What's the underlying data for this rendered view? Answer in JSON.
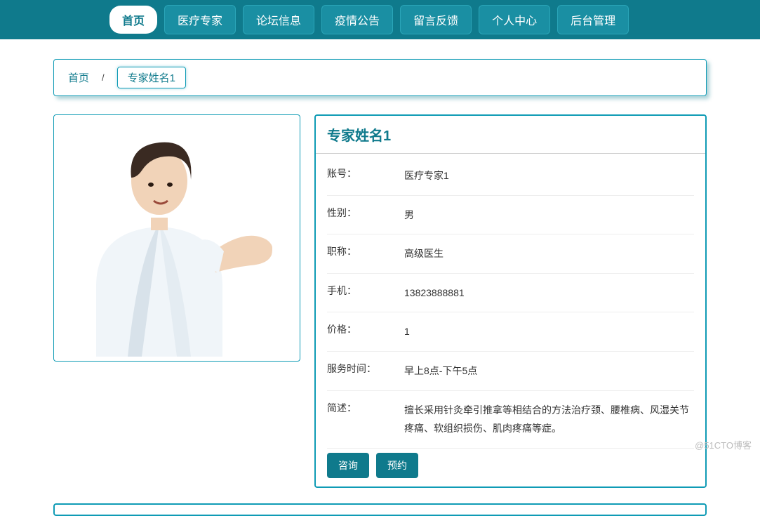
{
  "nav": {
    "tabs": [
      {
        "label": "首页",
        "active": true
      },
      {
        "label": "医疗专家",
        "active": false
      },
      {
        "label": "论坛信息",
        "active": false
      },
      {
        "label": "疫情公告",
        "active": false
      },
      {
        "label": "留言反馈",
        "active": false
      },
      {
        "label": "个人中心",
        "active": false
      },
      {
        "label": "后台管理",
        "active": false
      }
    ]
  },
  "breadcrumb": {
    "home": "首页",
    "sep": "/",
    "current": "专家姓名1"
  },
  "expert": {
    "title": "专家姓名1",
    "fields": {
      "account_label": "账号：",
      "account_value": "医疗专家1",
      "gender_label": "性别：",
      "gender_value": "男",
      "title_label": "职称：",
      "title_value": "高级医生",
      "phone_label": "手机：",
      "phone_value": "13823888881",
      "price_label": "价格：",
      "price_value": "1",
      "hours_label": "服务时间：",
      "hours_value": "早上8点-下午5点",
      "summary_label": "简述：",
      "summary_value": "擅长采用针灸牵引推拿等相结合的方法治疗颈、腰椎病、风湿关节疼痛、软组织损伤、肌肉疼痛等症。"
    },
    "actions": {
      "consult": "咨询",
      "book": "预约"
    }
  },
  "watermark": "@51CTO博客"
}
